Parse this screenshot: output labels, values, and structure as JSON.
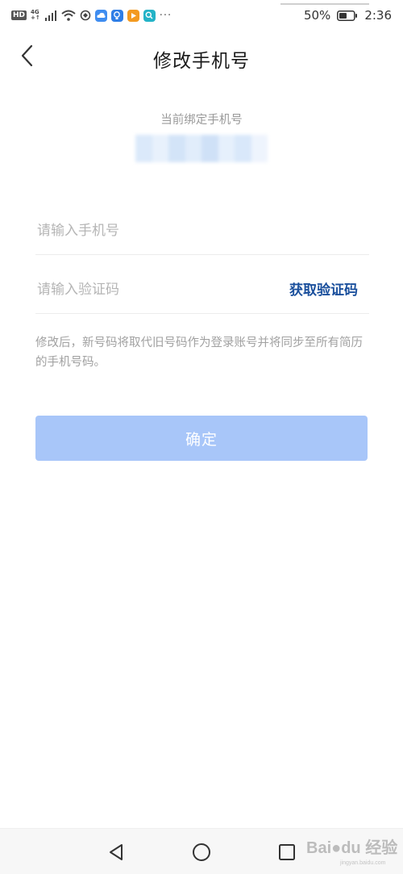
{
  "status_bar": {
    "hd_label": "HD",
    "network_label": "4G",
    "network_sub": "+↑",
    "more": "···",
    "battery_percent": "50%",
    "time": "2:36",
    "app_icons": [
      {
        "name": "weather-app-icon",
        "color": "#3f8df0"
      },
      {
        "name": "bulb-app-icon",
        "color": "#2f7ee6"
      },
      {
        "name": "video-app-icon",
        "color": "#f39a21"
      },
      {
        "name": "search-app-icon",
        "color": "#23b3c7"
      }
    ]
  },
  "header": {
    "title": "修改手机号",
    "back_icon": "chevron-left-icon"
  },
  "current_phone": {
    "label": "当前绑定手机号",
    "mask_colors": [
      "#dbe9fa",
      "#e8f1fc",
      "#d3e4f8",
      "#e1edfb",
      "#cfe1f7",
      "#e6f0fc",
      "#d9e8fa",
      "#eef4fd"
    ]
  },
  "form": {
    "phone_placeholder": "请输入手机号",
    "phone_value": "",
    "code_placeholder": "请输入验证码",
    "code_value": "",
    "get_code_label": "获取验证码"
  },
  "note": "修改后，新号码将取代旧号码作为登录账号并将同步至所有简历的手机号码。",
  "confirm": {
    "label": "确定",
    "disabled": true,
    "color": "#a8c6f9"
  },
  "nav_bar": {
    "back_icon": "triangle-back-icon",
    "home_icon": "circle-home-icon",
    "recent_icon": "square-recent-icon"
  },
  "watermark": {
    "logo_text": "Bai●du 经验",
    "sub_text": "jingyan.baidu.com"
  },
  "colors": {
    "accent": "#1a4f9c",
    "placeholder": "#b5b5b5",
    "hint": "#a1a1a1"
  }
}
